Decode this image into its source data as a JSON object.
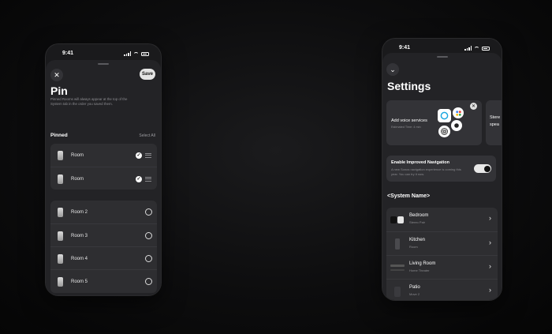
{
  "pin_screen": {
    "status_time": "9:41",
    "close_label": "✕",
    "save_label": "Save",
    "title": "Pin",
    "description": "Pinned Rooms will always appear at the top of the System tab in the order you saved them.",
    "pinned_header": "Pinned",
    "select_all": "Select All",
    "pinned_rooms": [
      {
        "label": "Room",
        "checked": true
      },
      {
        "label": "Room",
        "checked": true
      }
    ],
    "other_rooms": [
      {
        "label": "Room 2"
      },
      {
        "label": "Room 3"
      },
      {
        "label": "Room 4"
      },
      {
        "label": "Room 5"
      }
    ],
    "check_glyph": "✓"
  },
  "settings_screen": {
    "status_time": "9:41",
    "back_glyph": "⌄",
    "title": "Settings",
    "voice_card": {
      "title": "Add voice services",
      "subtitle": "Estimated Time: 4 min",
      "close_glyph": "✕"
    },
    "peek_card": {
      "line1": "Stere",
      "line2": "spea"
    },
    "nav_card": {
      "title": "Enable Improved Navigation",
      "description": "A new Sonos navigation experience is coming this year. You can try it now.",
      "toggle_on": true
    },
    "system_name": "<System Name>",
    "rooms": [
      {
        "name": "Bedroom",
        "sub": "Stereo Pair",
        "thumb": "speaker-pair"
      },
      {
        "name": "Kitchen",
        "sub": "Room",
        "thumb": "speaker-tall"
      },
      {
        "name": "Living Room",
        "sub": "Home Theater",
        "thumb": "soundbar"
      },
      {
        "name": "Patio",
        "sub": "Move 2",
        "thumb": "speaker-move"
      }
    ],
    "chevron_glyph": "›"
  }
}
